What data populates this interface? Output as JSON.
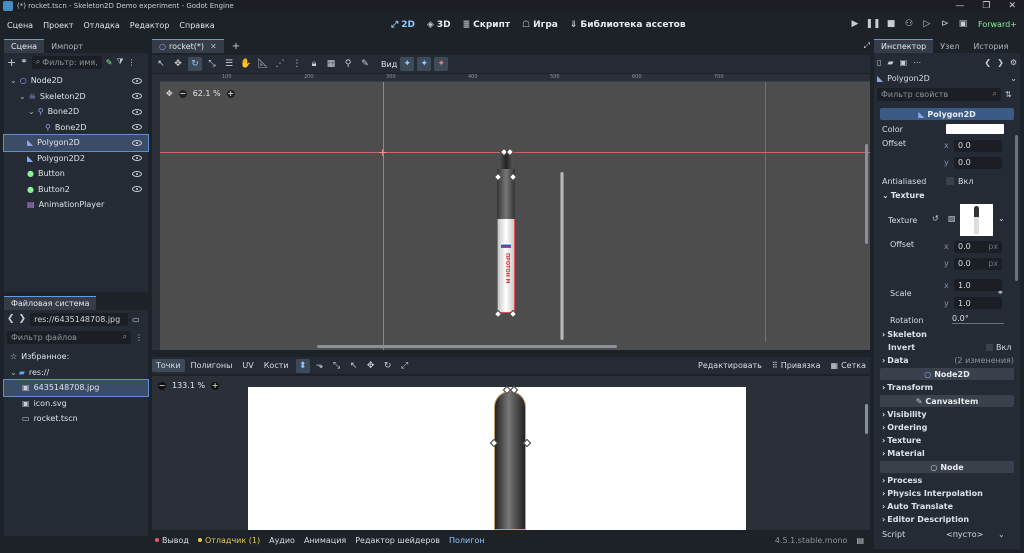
{
  "window": {
    "title": "(*) rocket.tscn - Skeleton2D Demo experiment - Godot Engine"
  },
  "menu": [
    "Сцена",
    "Проект",
    "Отладка",
    "Редактор",
    "Справка"
  ],
  "workspaces": [
    {
      "label": "2D",
      "icon": "2d-icon",
      "active": true
    },
    {
      "label": "3D",
      "icon": "3d-icon",
      "active": false
    },
    {
      "label": "Скрипт",
      "icon": "script-icon",
      "active": false
    },
    {
      "label": "Игра",
      "icon": "game-icon",
      "active": false
    },
    {
      "label": "Библиотека ассетов",
      "icon": "asset-library-icon",
      "active": false
    }
  ],
  "renderer": "Forward+",
  "scene_panel": {
    "tabs": [
      "Сцена",
      "Импорт"
    ],
    "filter_placeholder": "Фильтр: имя, t:",
    "nodes": [
      {
        "name": "Node2D",
        "indent": 0,
        "icon": "node2d-icon",
        "color": "#8da5f3",
        "selected": false
      },
      {
        "name": "Skeleton2D",
        "indent": 1,
        "icon": "skeleton2d-icon",
        "color": "#8da5f3",
        "selected": false
      },
      {
        "name": "Bone2D",
        "indent": 2,
        "icon": "bone2d-icon",
        "color": "#8da5f3",
        "selected": false
      },
      {
        "name": "Bone2D",
        "indent": 3,
        "icon": "bone2d-icon",
        "color": "#8da5f3",
        "selected": false
      },
      {
        "name": "Polygon2D",
        "indent": 1,
        "icon": "polygon2d-icon",
        "color": "#8da5f3",
        "selected": true
      },
      {
        "name": "Polygon2D2",
        "indent": 1,
        "icon": "polygon2d-icon",
        "color": "#8da5f3",
        "selected": false
      },
      {
        "name": "Button",
        "indent": 1,
        "icon": "button-icon",
        "color": "#8eef97",
        "selected": false
      },
      {
        "name": "Button2",
        "indent": 1,
        "icon": "button-icon",
        "color": "#8eef97",
        "selected": false
      },
      {
        "name": "AnimationPlayer",
        "indent": 1,
        "icon": "animation-player-icon",
        "color": "#c38ef1",
        "selected": false
      }
    ]
  },
  "filesystem": {
    "title": "Файловая система",
    "path": "res://6435148708.jpg",
    "filter_placeholder": "Фильтр файлов",
    "favorites": "Избранное:",
    "root": "res://",
    "files": [
      {
        "name": "6435148708.jpg",
        "icon": "image-file-icon",
        "selected": true
      },
      {
        "name": "icon.svg",
        "icon": "image-file-icon",
        "selected": false
      },
      {
        "name": "rocket.tscn",
        "icon": "scene-file-icon",
        "selected": false
      }
    ]
  },
  "editor_tabs": [
    {
      "label": "rocket(*)",
      "active": true
    }
  ],
  "viewport": {
    "view_menu": "Вид",
    "zoom": "62.1 %",
    "ruler_marks": [
      "100",
      "200",
      "300",
      "400",
      "500",
      "600",
      "700"
    ]
  },
  "polygon_editor": {
    "tabs": [
      "Точки",
      "Полигоны",
      "UV",
      "Кости"
    ],
    "active_tab": "Точки",
    "edit_label": "Редактировать",
    "snap_label": "Привязка",
    "grid_label": "Сетка",
    "zoom": "133.1 %"
  },
  "bottom_bar": {
    "items": [
      "Вывод",
      "Отладчик (1)",
      "Аудио",
      "Анимация",
      "Редактор шейдеров",
      "Полигон"
    ],
    "version": "4.5.1.stable.mono"
  },
  "inspector": {
    "tabs": [
      "Инспектор",
      "Узел",
      "История"
    ],
    "node_type": "Polygon2D",
    "filter_placeholder": "Фильтр свойств",
    "class_banner": "Polygon2D",
    "color_label": "Color",
    "color_value": "#ffffff",
    "offset_label": "Offset",
    "offset_x": "0.0",
    "offset_y": "0.0",
    "antialiased_label": "Antialiased",
    "on_label": "Вкл",
    "texture_section": "Texture",
    "texture_label": "Texture",
    "tex_offset_label": "Offset",
    "tex_offset_x": "0.0",
    "tex_offset_y": "0.0",
    "px": "px",
    "scale_label": "Scale",
    "scale_x": "1.0",
    "scale_y": "1.0",
    "rotation_label": "Rotation",
    "rotation_value": "0.0",
    "rotation_unit": "°",
    "skeleton_label": "Skeleton",
    "invert_label": "Invert",
    "invert_on": "Вкл",
    "data_label": "Data",
    "data_changes": "(2 изменения)",
    "node2d_banner": "Node2D",
    "transform_label": "Transform",
    "canvasitem_banner": "CanvasItem",
    "canvas_sections": [
      "Visibility",
      "Ordering",
      "Texture",
      "Material"
    ],
    "node_banner": "Node",
    "node_sections": [
      "Process",
      "Physics Interpolation",
      "Auto Translate",
      "Editor Description"
    ],
    "script_label": "Script",
    "script_value": "<пусто>"
  },
  "rocket_label": "ПРОТОН М",
  "colors": {
    "accent": "#5d9ee8",
    "node2d": "#8da5f3",
    "control": "#8eef97",
    "warning": "#e6c84f",
    "error": "#e85d5d"
  }
}
